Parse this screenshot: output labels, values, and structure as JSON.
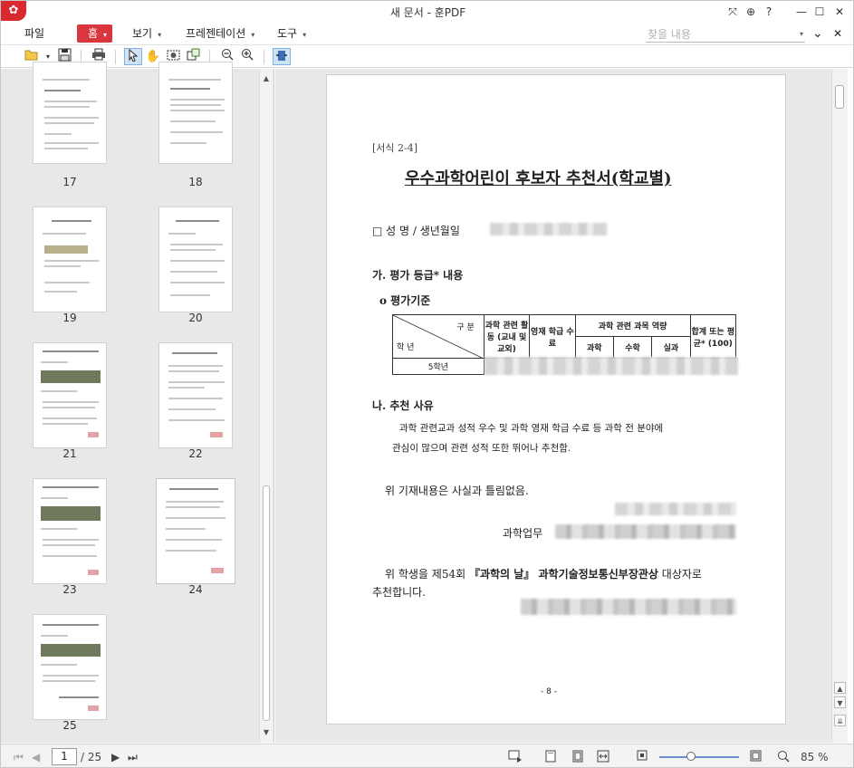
{
  "window": {
    "title": "새 문서 - 훈PDF",
    "logo_icon": "app-logo-icon"
  },
  "title_buttons": [
    "⤧",
    "⊕",
    "?",
    "—",
    "☐",
    "✕"
  ],
  "menu": {
    "file": "파일",
    "home": "홈",
    "view": "보기",
    "presentation": "프레젠테이션",
    "tools": "도구",
    "search_placeholder": "찾을 내용",
    "caret": "▾",
    "nav_down": "⌄",
    "nav_close": "✕"
  },
  "thumbnails": [
    {
      "page": "17"
    },
    {
      "page": "18"
    },
    {
      "page": "19"
    },
    {
      "page": "20"
    },
    {
      "page": "21"
    },
    {
      "page": "22"
    },
    {
      "page": "23"
    },
    {
      "page": "24"
    },
    {
      "page": "25"
    }
  ],
  "document": {
    "form_no": "[서식 2-4]",
    "title": "우수과학어린이 후보자 추천서(학교별)",
    "name_line": "□ 성 명 / 생년월일",
    "section_ga": "가. 평가 등급* 내용",
    "criteria": "o  평가기준",
    "table": {
      "h_gubun": "구    분",
      "h_haknyeon": "학   년",
      "h_activity": "과학 관련 활동 (교내 및 교외)",
      "h_gifted": "영재 학급 수료",
      "h_subject": "과학 관련 과목 역량",
      "h_total": "합계 또는 평균* (100)",
      "h_science": "과학",
      "h_math": "수학",
      "h_practical": "실과",
      "row_grade": "5학년"
    },
    "section_na": "나. 추천 사유",
    "reason_line1": "과학 관련교과 성적 우수 및 과학 영재 학급 수료 등 과학 전 분야에",
    "reason_line2": "관심이 많으며 관련 성적 또한 뛰어나 추천함.",
    "truth_statement": "위 기재내용은 사실과 틀림없음.",
    "sci_officer": "과학업무",
    "recommend_line1": "위  학생을  제54회",
    "recommend_bold": "『과학의 날』 과학기술정보통신부장관상",
    "recommend_line1_end": "대상자로",
    "recommend_line2": "추천합니다.",
    "page_footer": "- 8 -"
  },
  "status": {
    "current_page": "1",
    "total_pages": "/ 25",
    "zoom": "85 %",
    "zoom_level": 0.4
  }
}
